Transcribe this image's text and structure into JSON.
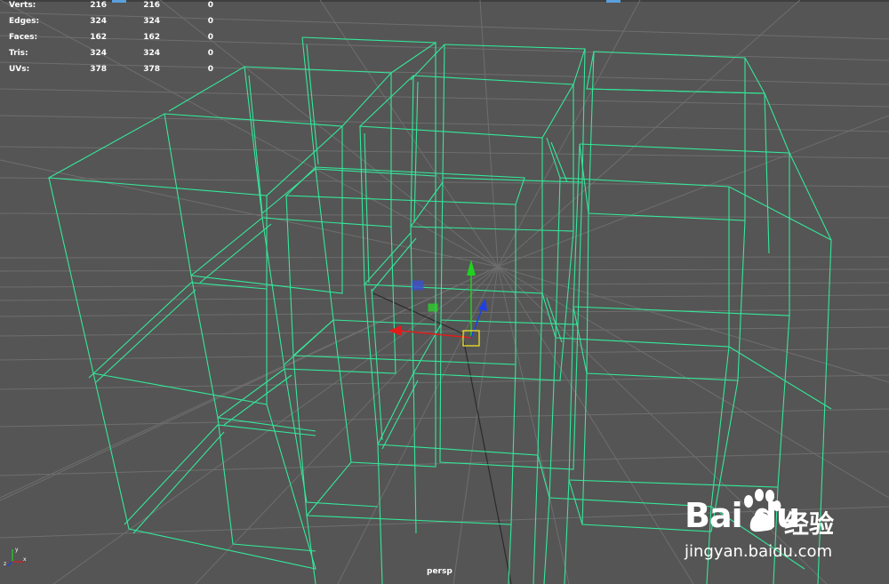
{
  "hud": {
    "rows": [
      {
        "label": "Verts:",
        "v1": "216",
        "v2": "216",
        "v3": "0"
      },
      {
        "label": "Edges:",
        "v1": "324",
        "v2": "324",
        "v3": "0"
      },
      {
        "label": "Faces:",
        "v1": "162",
        "v2": "162",
        "v3": "0"
      },
      {
        "label": "Tris:",
        "v1": "324",
        "v2": "324",
        "v3": "0"
      },
      {
        "label": "UVs:",
        "v1": "378",
        "v2": "378",
        "v3": "0"
      }
    ]
  },
  "camera": {
    "name": "persp"
  },
  "watermark": {
    "brand": "Bai  du",
    "cn": "经验",
    "url": "jingyan.baidu.com"
  },
  "colors": {
    "background": "#555555",
    "grid": "#6e6e6e",
    "wireframe": "#33e89a",
    "axis_x": "#e21b1b",
    "axis_y": "#1fd21f",
    "axis_z": "#1f3fe6",
    "pivot": "#f0e020"
  },
  "icons": [
    "move-manipulator-icon",
    "view-axis-triad-icon",
    "baidu-paw-logo-icon"
  ]
}
